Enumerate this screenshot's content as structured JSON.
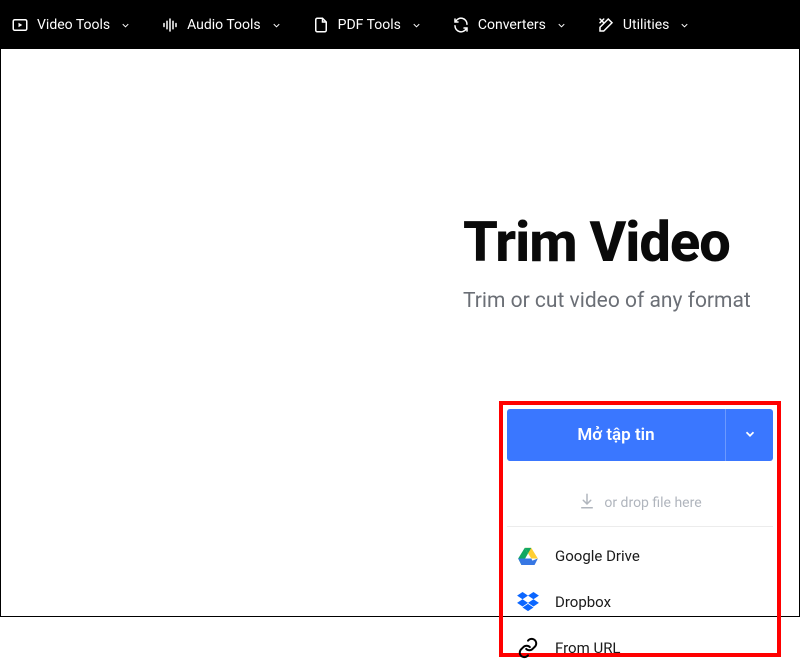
{
  "nav": {
    "items": [
      {
        "label": "Video Tools"
      },
      {
        "label": "Audio Tools"
      },
      {
        "label": "PDF Tools"
      },
      {
        "label": "Converters"
      },
      {
        "label": "Utilities"
      }
    ]
  },
  "hero": {
    "title": "Trim Video",
    "subtitle": "Trim or cut video of any format"
  },
  "panel": {
    "open_label": "Mở tập tin",
    "drop_label": "or drop file here",
    "sources": [
      {
        "label": "Google Drive"
      },
      {
        "label": "Dropbox"
      },
      {
        "label": "From URL"
      }
    ]
  }
}
